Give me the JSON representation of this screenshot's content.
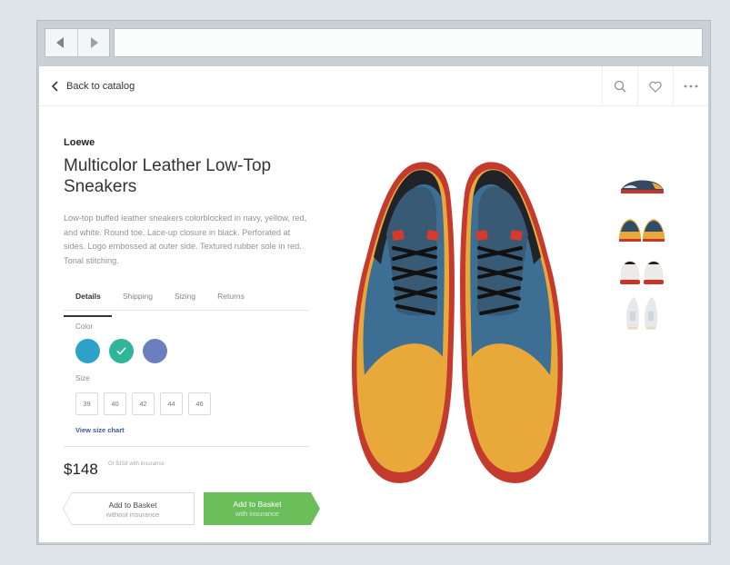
{
  "browser": {
    "back_icon": "chevron-left-icon",
    "forward_icon": "chevron-right-icon",
    "address": ""
  },
  "topbar": {
    "back_label": "Back to catalog",
    "icons": [
      "search-icon",
      "heart-icon",
      "more-icon"
    ]
  },
  "product": {
    "brand": "Loewe",
    "title": "Multicolor Leather Low-Top Sneakers",
    "description": "Low-top buffed leather sneakers colorblocked in navy, yellow, red, and white. Round toe. Lace-up closure in black. Perforated at sides. Logo embossed at outer side. Textured rubber sole in red. Tonal stitching.",
    "tabs": [
      {
        "label": "Details",
        "active": true
      },
      {
        "label": "Shipping",
        "active": false
      },
      {
        "label": "Sizing",
        "active": false
      },
      {
        "label": "Returns",
        "active": false
      }
    ],
    "color_label": "Color",
    "colors": [
      {
        "hex": "#2ea3c9",
        "selected": false
      },
      {
        "hex": "#2fb59a",
        "selected": true
      },
      {
        "hex": "#6b7fc0",
        "selected": false
      }
    ],
    "size_label": "Size",
    "sizes": [
      "39",
      "40",
      "42",
      "44",
      "46"
    ],
    "size_chart_link": "View size chart",
    "price": "$148",
    "price_note": "Or $158 with insurance",
    "buttons": {
      "basket_without": {
        "label": "Add to Basket",
        "sub": "without insurance"
      },
      "basket_with": {
        "label": "Add to Basket",
        "sub": "with insurance"
      }
    },
    "accent_colors": {
      "green": "#6abf5b",
      "blue_link": "#3b5998"
    }
  },
  "gallery": {
    "main_image": "sneakers-front-pair",
    "thumbnails": [
      "sneaker-side-view",
      "sneakers-front-view",
      "sneakers-back-view",
      "sneakers-top-view"
    ]
  }
}
